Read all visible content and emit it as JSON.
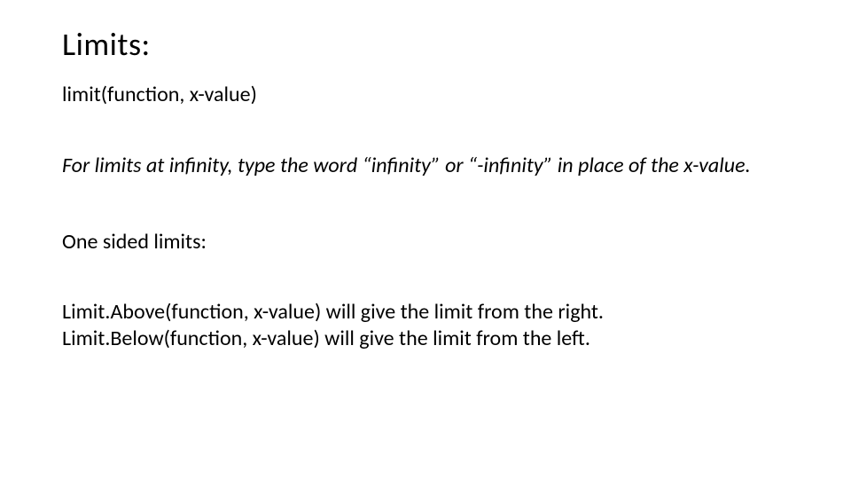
{
  "title": "Limits:",
  "syntax": "limit(function, x-value)",
  "infinity_note": "For limits at infinity, type the word “infinity” or “-infinity” in place of the x-value.",
  "one_sided_heading": "One sided limits:",
  "limit_above": "Limit.Above(function, x-value) will give the limit from the right.",
  "limit_below": "Limit.Below(function, x-value) will give the limit from the left."
}
